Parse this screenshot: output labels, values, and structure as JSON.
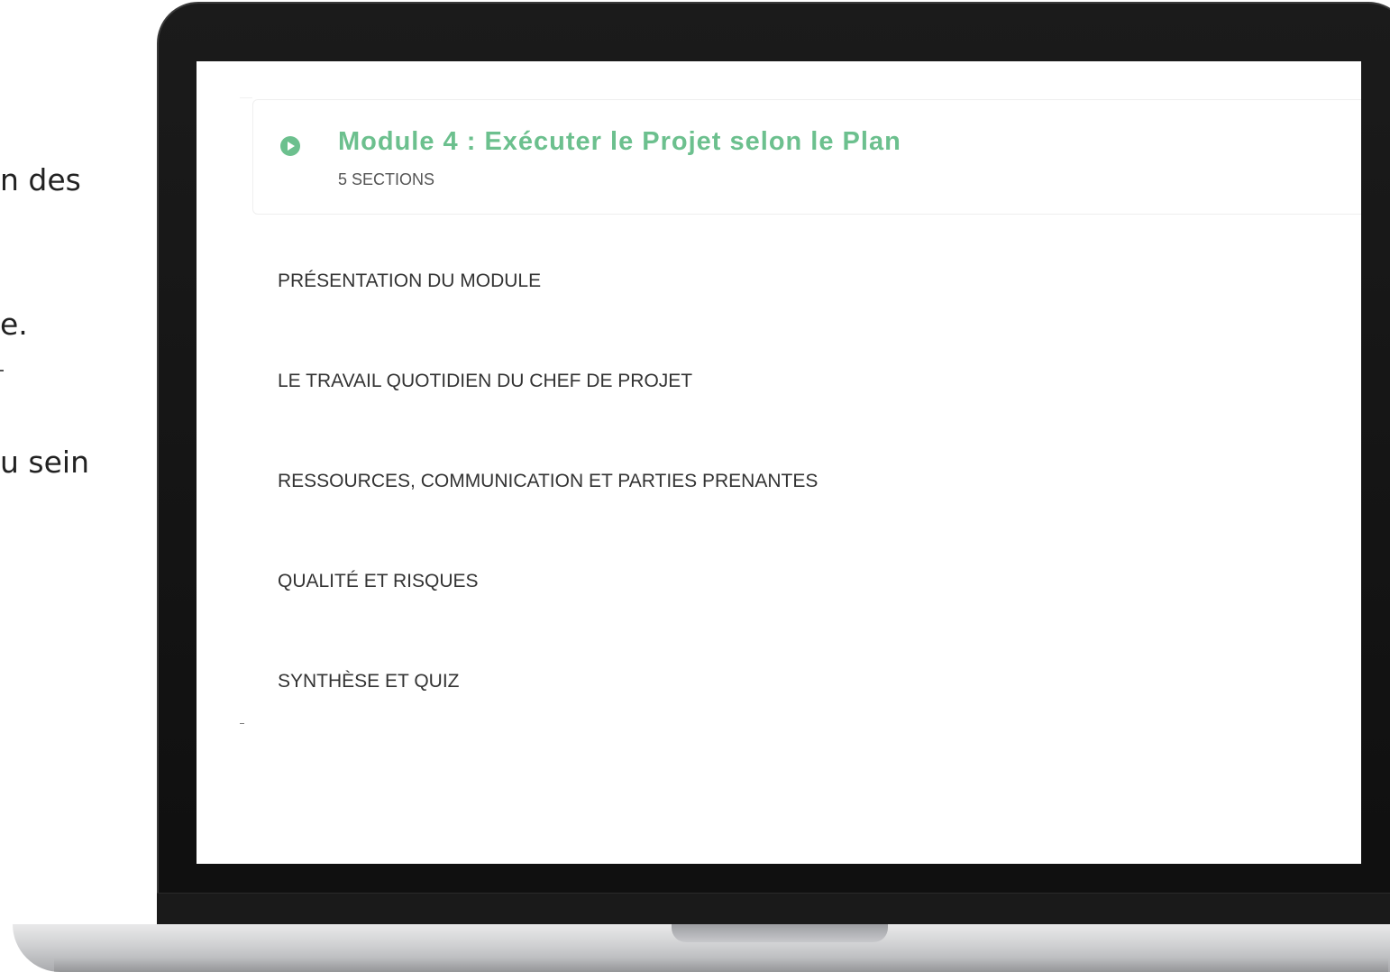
{
  "side_text": {
    "line1": "n des",
    "line2": "e.",
    "line3": "u sein"
  },
  "module": {
    "title": "Module 4 : Exécuter le Projet selon le Plan",
    "sections_count": "5 SECTIONS",
    "icon": "play-circle-icon",
    "accent_color": "#6cc08e"
  },
  "sections": [
    "PRÉSENTATION DU MODULE",
    "LE TRAVAIL QUOTIDIEN DU CHEF DE PROJET",
    "RESSOURCES, COMMUNICATION ET PARTIES PRENANTES",
    "QUALITÉ ET RISQUES",
    "SYNTHÈSE ET QUIZ"
  ]
}
